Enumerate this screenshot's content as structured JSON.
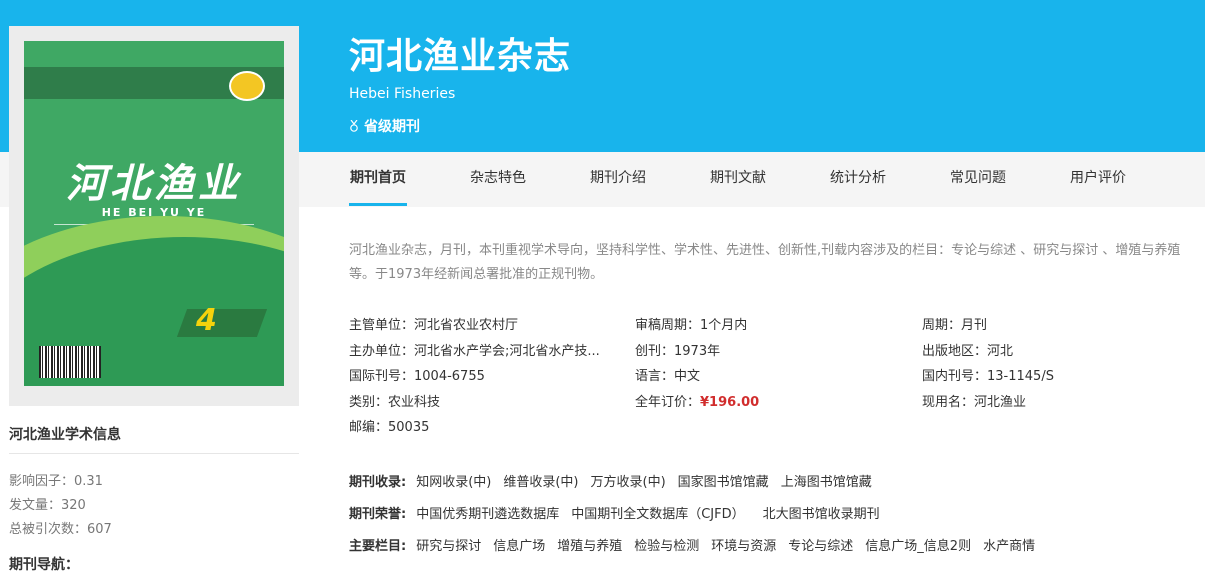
{
  "header": {
    "title": "河北渔业杂志",
    "english_name": "Hebei Fisheries",
    "level": "省级期刊",
    "level_icon": "medal-icon",
    "accent_color": "#18b4ec"
  },
  "cover": {
    "title": "河北渔业",
    "pinyin": "HE BEI YU YE",
    "issue_number": "4"
  },
  "tabs": [
    {
      "label": "期刊首页",
      "active": true
    },
    {
      "label": "杂志特色",
      "active": false
    },
    {
      "label": "期刊介绍",
      "active": false
    },
    {
      "label": "期刊文献",
      "active": false
    },
    {
      "label": "统计分析",
      "active": false
    },
    {
      "label": "常见问题",
      "active": false
    },
    {
      "label": "用户评价",
      "active": false
    }
  ],
  "description": "河北渔业杂志，月刊，本刊重视学术导向，坚持科学性、学术性、先进性、创新性,刊载内容涉及的栏目：专论与综述 、研究与探讨 、增殖与养殖等。于1973年经新闻总署批准的正规刊物。",
  "info": {
    "supervisor": "主管单位：河北省农业农村厅",
    "sponsor": "主办单位：河北省水产学会;河北省水产技...",
    "issn": "国际刊号：1004-6755",
    "category": "类别：农业科技",
    "postcode": "邮编：50035",
    "review_cycle": "审稿周期：1个月内",
    "founded": "创刊：1973年",
    "language": "语言：中文",
    "price_label": "全年订价：",
    "price_value": "¥196.00",
    "frequency": "周期：月刊",
    "region": "出版地区：河北",
    "cn": "国内刊号：13-1145/S",
    "current_name": "现用名：河北渔业"
  },
  "indexing": {
    "label": "期刊收录:",
    "items": [
      "知网收录(中)",
      "维普收录(中)",
      "万方收录(中)",
      "国家图书馆馆藏",
      "上海图书馆馆藏"
    ]
  },
  "honors": {
    "label": "期刊荣誉:",
    "items": [
      "中国优秀期刊遴选数据库",
      "中国期刊全文数据库（CJFD）",
      "北大图书馆收录期刊"
    ]
  },
  "columns": {
    "label": "主要栏目:",
    "items": [
      "研究与探讨",
      "信息广场",
      "增殖与养殖",
      "检验与检测",
      "环境与资源",
      "专论与综述",
      "信息广场_信息2则",
      "水产商情"
    ]
  },
  "left_panel": {
    "title": "河北渔业学术信息",
    "impact_factor": "影响因子：0.31",
    "articles": "发文量：320",
    "citations": "总被引次数：607",
    "section": "期刊导航："
  }
}
